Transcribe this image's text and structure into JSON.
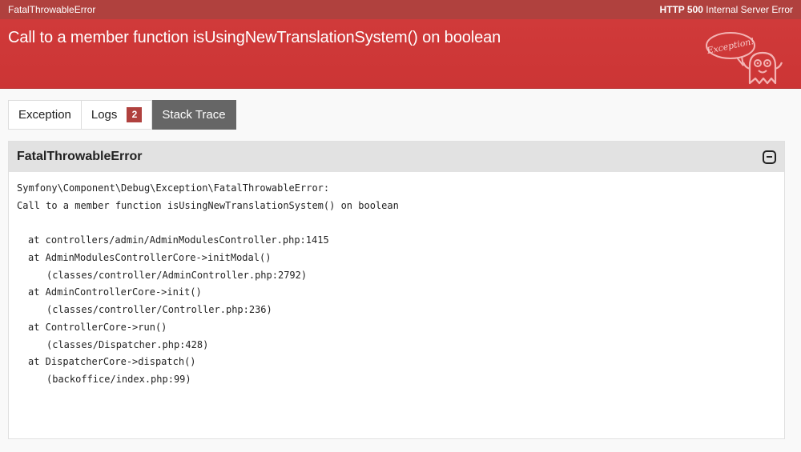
{
  "topbar": {
    "left_text": "FatalThrowableError",
    "status_code": "HTTP 500",
    "status_text": "Internal Server Error"
  },
  "header": {
    "message": "Call to a member function isUsingNewTranslationSystem() on boolean",
    "mascot_bubble": "Exception!"
  },
  "tabs": [
    {
      "label": "Exception"
    },
    {
      "label": "Logs",
      "badge": "2"
    },
    {
      "label": "Stack Trace",
      "active": true
    }
  ],
  "panel": {
    "title": "FatalThrowableError",
    "exception_class": "Symfony\\Component\\Debug\\Exception\\FatalThrowableError:",
    "exception_message": "Call to a member function isUsingNewTranslationSystem() on boolean",
    "frames": [
      {
        "at": "at controllers/admin/AdminModulesController.php:1415",
        "loc": ""
      },
      {
        "at": "at AdminModulesControllerCore->initModal()",
        "loc": "(classes/controller/AdminController.php:2792)"
      },
      {
        "at": "at AdminControllerCore->init()",
        "loc": "(classes/controller/Controller.php:236)"
      },
      {
        "at": "at ControllerCore->run()",
        "loc": "(classes/Dispatcher.php:428)"
      },
      {
        "at": "at DispatcherCore->dispatch()",
        "loc": "(backoffice/index.php:99)"
      }
    ]
  },
  "colors": {
    "header_bg": "#d03a3a",
    "topbar_bg": "#b0413e",
    "active_tab_bg": "#666666",
    "badge_bg": "#b0413e"
  }
}
